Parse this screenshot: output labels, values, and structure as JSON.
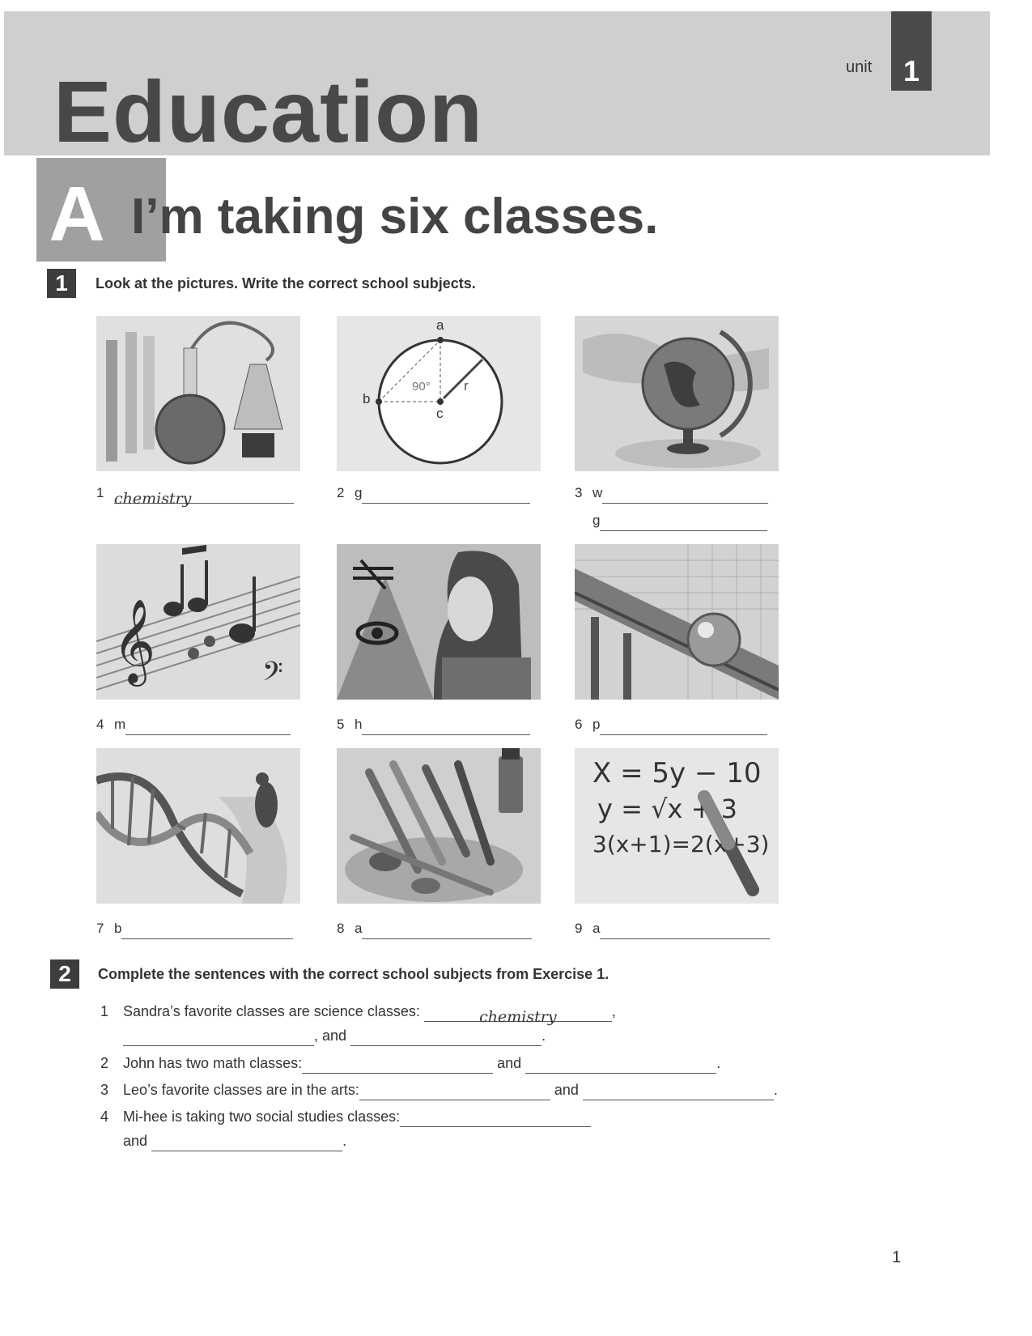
{
  "header": {
    "unit_label": "unit",
    "unit_number": "1",
    "title": "Education"
  },
  "lesson": {
    "letter": "A",
    "title": "I’m taking six classes."
  },
  "exercise1": {
    "number": "1",
    "instruction": "Look at the pictures. Write the correct school subjects.",
    "items": [
      {
        "num": "1",
        "start": "",
        "answer": "chemistry",
        "image": "chemistry-flasks-image"
      },
      {
        "num": "2",
        "start": "g",
        "answer": "",
        "image": "geometry-circle-image"
      },
      {
        "num": "3",
        "start": "w",
        "second_start": "g",
        "answer": "",
        "image": "globe-image"
      },
      {
        "num": "4",
        "start": "m",
        "answer": "",
        "image": "music-notes-image"
      },
      {
        "num": "5",
        "start": "h",
        "answer": "",
        "image": "egyptian-history-image"
      },
      {
        "num": "6",
        "start": "p",
        "answer": "",
        "image": "physics-ball-ramp-image"
      },
      {
        "num": "7",
        "start": "b",
        "answer": "",
        "image": "dna-beetle-image"
      },
      {
        "num": "8",
        "start": "a",
        "answer": "",
        "image": "art-brushes-image"
      },
      {
        "num": "9",
        "start": "a",
        "answer": "",
        "image": "algebra-equations-image"
      }
    ],
    "diagram_labels": {
      "a": "a",
      "b": "b",
      "c": "c",
      "r": "r",
      "angle": "90°"
    },
    "equations": [
      "X = 5y − 10",
      "y = √x + 3",
      "3(x+1)=2(x+3)"
    ]
  },
  "exercise2": {
    "number": "2",
    "instruction": "Complete the sentences with the correct school subjects from Exercise 1.",
    "sentences": [
      {
        "num": "1",
        "text": "Sandra’s favorite classes are science classes:",
        "answer": "chemistry",
        "comma": ",",
        "and": ", and",
        "end": "."
      },
      {
        "num": "2",
        "text": "John has two math classes:",
        "and": "and",
        "end": "."
      },
      {
        "num": "3",
        "text": "Leo’s favorite classes are in the arts:",
        "and": "and",
        "end": "."
      },
      {
        "num": "4",
        "text": "Mi-hee is taking two social studies classes:",
        "and": "and",
        "end": "."
      }
    ]
  },
  "page_number": "1"
}
